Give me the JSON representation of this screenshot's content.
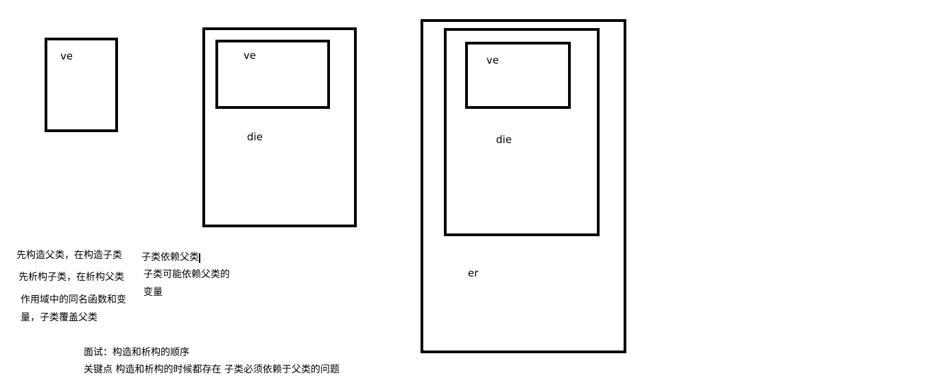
{
  "diagram": {
    "obj1": {
      "inner": "ve"
    },
    "obj2": {
      "inner": "ve",
      "outer": "die"
    },
    "obj3": {
      "inner": "ve",
      "middle": "die",
      "outer": "er"
    }
  },
  "notes": {
    "line1": "先构造父类，在构造子类",
    "line2": "先析构子类，在析构父类",
    "line3": "作用域中的同名函数和变",
    "line4": "量，子类覆盖父类",
    "side1": "子类依赖父类",
    "side2": "子类可能依赖父类的",
    "side3": "变量",
    "interview": "面试：构造和析构的顺序",
    "keypoint": "关键点 构造和析构的时候都存在 子类必须依赖于父类的问题"
  }
}
